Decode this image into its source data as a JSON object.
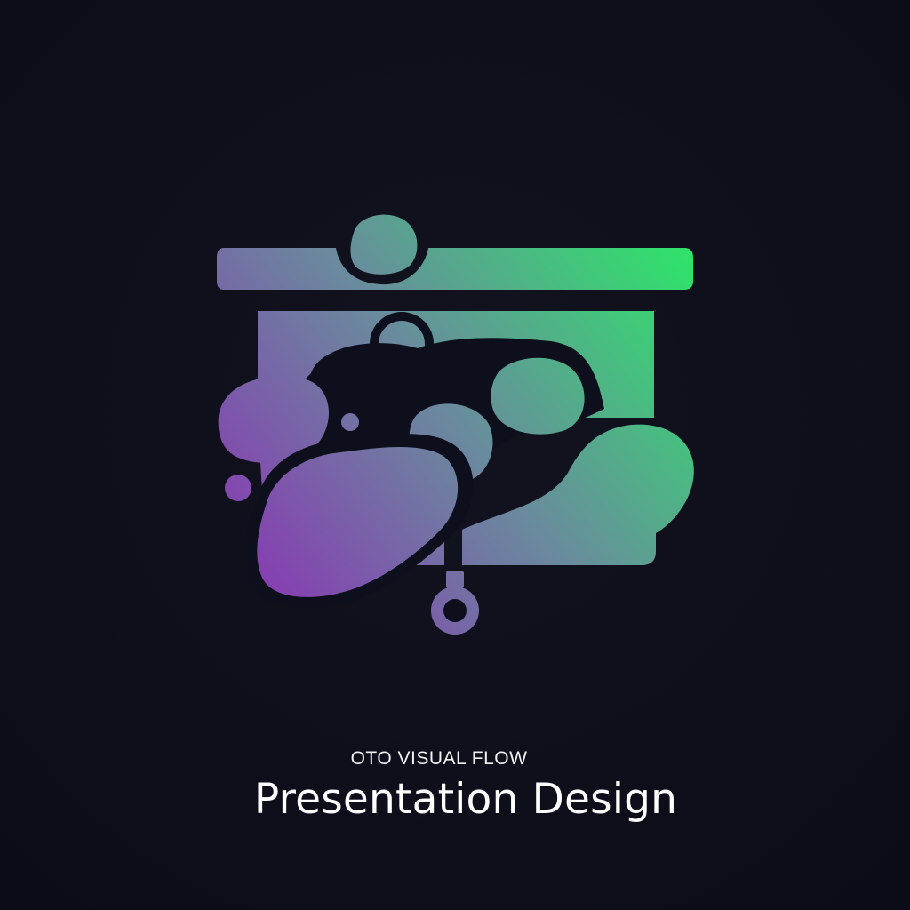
{
  "brand": {
    "tagline": "OTO VISUAL FLOW",
    "headline": "Presentation Design"
  },
  "logo": {
    "icon": "projector-screen-blob-icon",
    "gradient": {
      "purple": "#8a34b4",
      "mid": "#6a8a9e",
      "green": "#2fe36a"
    },
    "cutout_color": "#0e0f1c"
  }
}
